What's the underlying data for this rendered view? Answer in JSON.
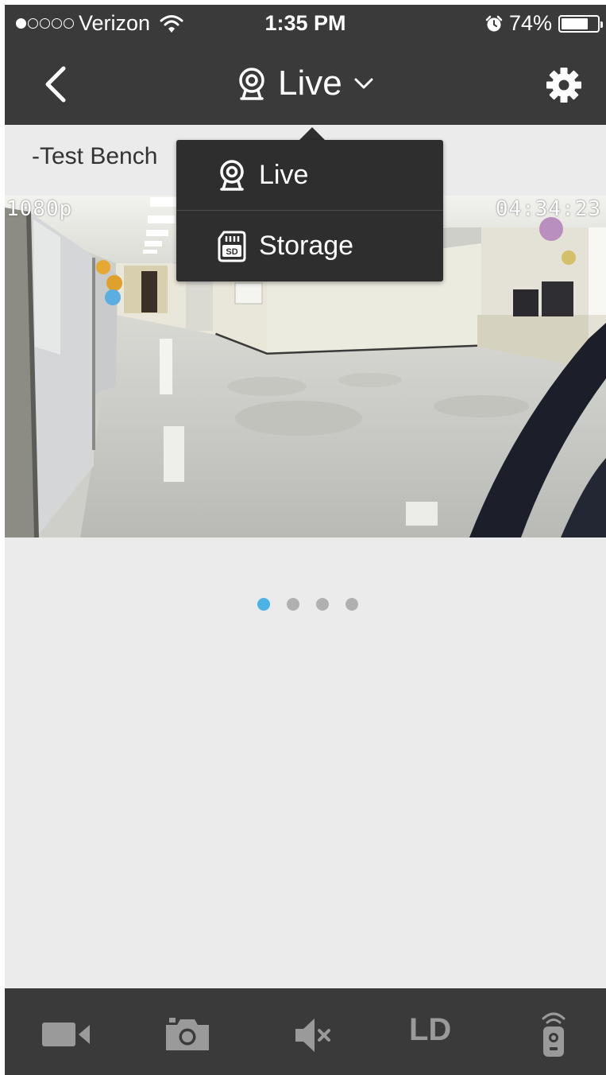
{
  "status_bar": {
    "carrier": "Verizon",
    "signal_dots_filled": 1,
    "signal_dots_total": 5,
    "time": "1:35 PM",
    "battery_text": "74%",
    "battery_level": 0.74
  },
  "nav": {
    "title": "Live",
    "back_icon": "chevron-left-icon",
    "settings_icon": "gear-icon",
    "title_icon": "webcam-icon",
    "dropdown_icon": "chevron-down-icon"
  },
  "camera": {
    "name": "-Test Bench"
  },
  "video": {
    "resolution_overlay": "1080p",
    "time_overlay": "04:34:23 AM"
  },
  "dropdown_menu": {
    "items": [
      {
        "label": "Live",
        "icon": "webcam-icon"
      },
      {
        "label": "Storage",
        "icon": "sd-card-icon"
      }
    ]
  },
  "pager": {
    "total": 4,
    "active_index": 0,
    "active_color": "#4db2e6",
    "inactive_color": "#b0b0b0"
  },
  "toolbar": {
    "items": [
      {
        "icon": "video-camera-icon"
      },
      {
        "icon": "camera-icon"
      },
      {
        "icon": "mute-icon"
      },
      {
        "label": "LD"
      },
      {
        "icon": "remote-icon"
      }
    ]
  },
  "colors": {
    "bar_background": "#3a3a3a",
    "page_background": "#ebebeb",
    "menu_background": "#2e2e2e",
    "toolbar_icon": "#9a9a9a"
  }
}
